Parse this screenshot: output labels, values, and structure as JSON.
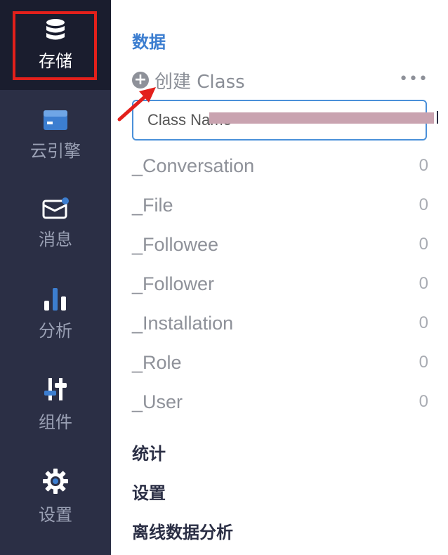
{
  "sidebar": {
    "items": [
      {
        "label": "存储",
        "icon": "database-icon",
        "active": true
      },
      {
        "label": "云引擎",
        "icon": "server-icon"
      },
      {
        "label": "消息",
        "icon": "message-icon"
      },
      {
        "label": "分析",
        "icon": "bar-chart-icon"
      },
      {
        "label": "组件",
        "icon": "sliders-icon"
      },
      {
        "label": "设置",
        "icon": "gear-icon"
      }
    ]
  },
  "main": {
    "section_data": "数据",
    "create_label": "创建 Class",
    "more_label": "•••",
    "input": {
      "value": "Class Name",
      "placeholder": "Class Name"
    },
    "classes": [
      {
        "name": "_Conversation",
        "count": "0"
      },
      {
        "name": "_File",
        "count": "0"
      },
      {
        "name": "_Followee",
        "count": "0"
      },
      {
        "name": "_Follower",
        "count": "0"
      },
      {
        "name": "_Installation",
        "count": "0"
      },
      {
        "name": "_Role",
        "count": "0"
      },
      {
        "name": "_User",
        "count": "0"
      }
    ],
    "sections": [
      "统计",
      "设置",
      "离线数据分析"
    ]
  },
  "colors": {
    "rail_bg": "#2b2f45",
    "active_bg": "#1a1d2e",
    "accent": "#3c7ed0",
    "highlight_frame": "#e3201b",
    "input_border": "#4a90d9"
  }
}
